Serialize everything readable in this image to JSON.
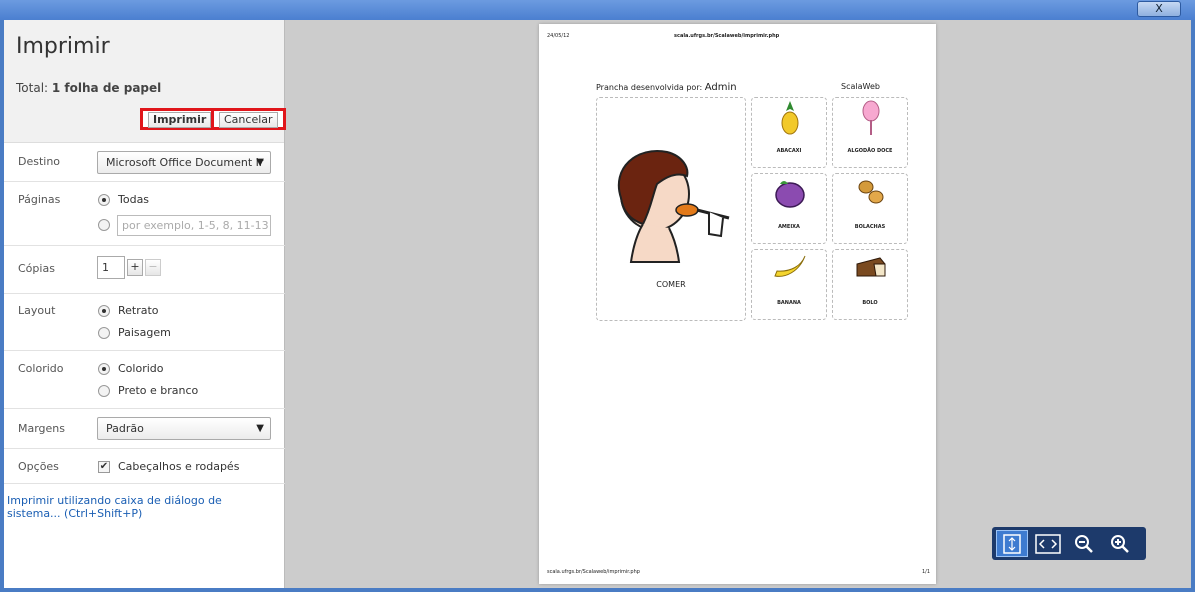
{
  "window": {
    "close_label": "X"
  },
  "panel": {
    "title": "Imprimir",
    "total_prefix": "Total:",
    "total_value": "1 folha de papel",
    "print_button": "Imprimir",
    "cancel_button": "Cancelar",
    "destination": {
      "label": "Destino",
      "value": "Microsoft Office Document Ir"
    },
    "pages": {
      "label": "Páginas",
      "all": "Todas",
      "range_placeholder": "por exemplo, 1-5, 8, 11-13"
    },
    "copies": {
      "label": "Cópias",
      "value": "1",
      "plus": "+",
      "minus": "−"
    },
    "layout": {
      "label": "Layout",
      "portrait": "Retrato",
      "landscape": "Paisagem"
    },
    "color": {
      "label": "Colorido",
      "color": "Colorido",
      "bw": "Preto e branco"
    },
    "margins": {
      "label": "Margens",
      "value": "Padrão"
    },
    "options": {
      "label": "Opções",
      "headers_footers": "Cabeçalhos e rodapés"
    },
    "system_dialog_link": "Imprimir utilizando caixa de diálogo de sistema... (Ctrl+Shift+P)"
  },
  "preview": {
    "date": "24/05/12",
    "url": "scala.ufrgs.br/Scalaweb/imprimir.php",
    "footer_url": "scala.ufrgs.br/Scalaweb/imprimir.php",
    "page_number": "1/1",
    "developed_by": "Prancha desenvolvida por:",
    "author": "Admin",
    "brand": "ScalaWeb",
    "main_card": "COMER",
    "cards": [
      "ABACAXI",
      "ALGODÃO DOCE",
      "AMEIXA",
      "BOLACHAS",
      "BANANA",
      "BOLO"
    ]
  },
  "zoom_bar": {
    "icons": [
      "fit-page-icon",
      "fit-width-icon",
      "zoom-out-icon",
      "zoom-in-icon"
    ]
  }
}
